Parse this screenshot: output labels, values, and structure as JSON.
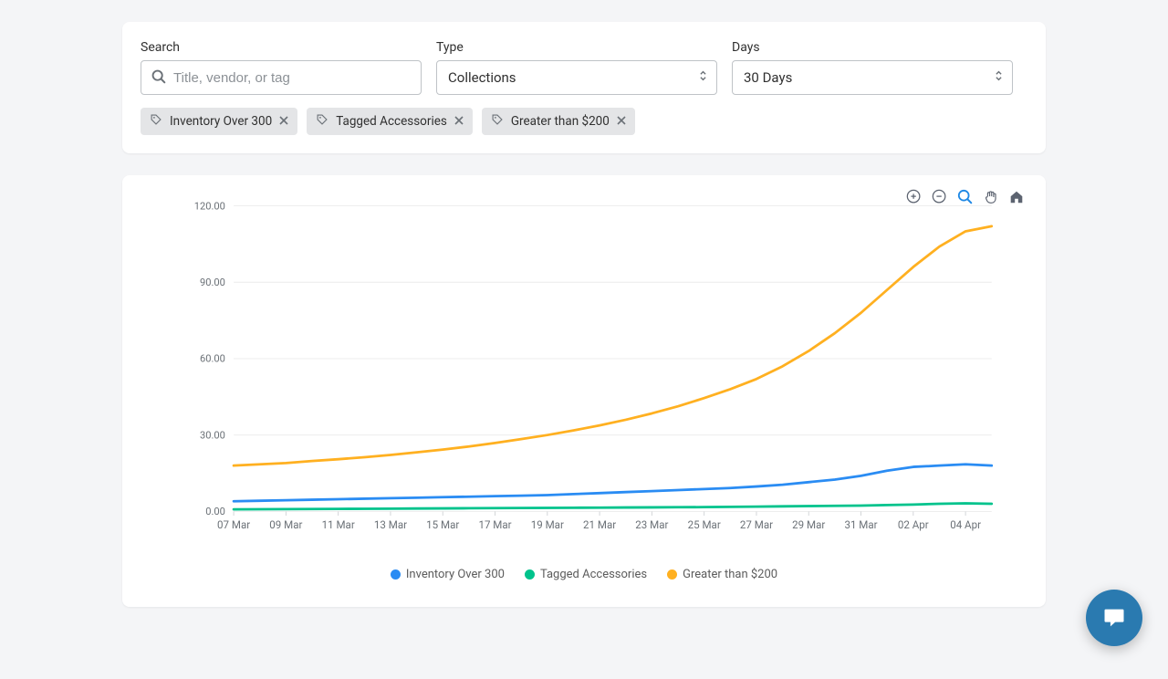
{
  "filters": {
    "search_label": "Search",
    "search_placeholder": "Title, vendor, or tag",
    "type_label": "Type",
    "type_value": "Collections",
    "days_label": "Days",
    "days_value": "30 Days"
  },
  "chips": [
    {
      "label": "Inventory Over 300"
    },
    {
      "label": "Tagged Accessories"
    },
    {
      "label": "Greater than $200"
    }
  ],
  "chart_data": {
    "type": "line",
    "ylabel": "",
    "xlabel": "",
    "ylim": [
      0,
      120
    ],
    "yticks": [
      "0.00",
      "30.00",
      "60.00",
      "90.00",
      "120.00"
    ],
    "categories": [
      "07 Mar",
      "08 Mar",
      "09 Mar",
      "10 Mar",
      "11 Mar",
      "12 Mar",
      "13 Mar",
      "14 Mar",
      "15 Mar",
      "16 Mar",
      "17 Mar",
      "18 Mar",
      "19 Mar",
      "20 Mar",
      "21 Mar",
      "22 Mar",
      "23 Mar",
      "24 Mar",
      "25 Mar",
      "26 Mar",
      "27 Mar",
      "28 Mar",
      "29 Mar",
      "30 Mar",
      "31 Mar",
      "01 Apr",
      "02 Apr",
      "03 Apr",
      "04 Apr",
      "05 Apr"
    ],
    "xticks": [
      "07 Mar",
      "09 Mar",
      "11 Mar",
      "13 Mar",
      "15 Mar",
      "17 Mar",
      "19 Mar",
      "21 Mar",
      "23 Mar",
      "25 Mar",
      "27 Mar",
      "29 Mar",
      "31 Mar",
      "02 Apr",
      "04 Apr"
    ],
    "series": [
      {
        "name": "Inventory Over 300",
        "color": "#2a8cf3",
        "values": [
          4,
          4.2,
          4.4,
          4.6,
          4.8,
          5,
          5.2,
          5.4,
          5.6,
          5.8,
          6,
          6.2,
          6.4,
          6.8,
          7.2,
          7.6,
          8,
          8.4,
          8.8,
          9.2,
          9.8,
          10.5,
          11.5,
          12.5,
          14,
          16,
          17.5,
          18,
          18.5,
          18
        ]
      },
      {
        "name": "Tagged Accessories",
        "color": "#00c38c",
        "values": [
          0.8,
          0.85,
          0.9,
          0.95,
          1.0,
          1.05,
          1.1,
          1.15,
          1.2,
          1.25,
          1.3,
          1.35,
          1.4,
          1.45,
          1.5,
          1.55,
          1.6,
          1.65,
          1.7,
          1.8,
          1.9,
          2.0,
          2.1,
          2.2,
          2.3,
          2.5,
          2.7,
          3.0,
          3.2,
          3.0
        ]
      },
      {
        "name": "Greater than $200",
        "color": "#ffb020",
        "values": [
          18,
          18.5,
          19,
          19.8,
          20.5,
          21.3,
          22.2,
          23.2,
          24.3,
          25.5,
          26.9,
          28.4,
          30,
          31.8,
          33.8,
          36,
          38.5,
          41.3,
          44.5,
          48,
          52,
          57,
          63,
          70,
          78,
          87,
          96,
          104,
          110,
          112
        ]
      }
    ]
  }
}
